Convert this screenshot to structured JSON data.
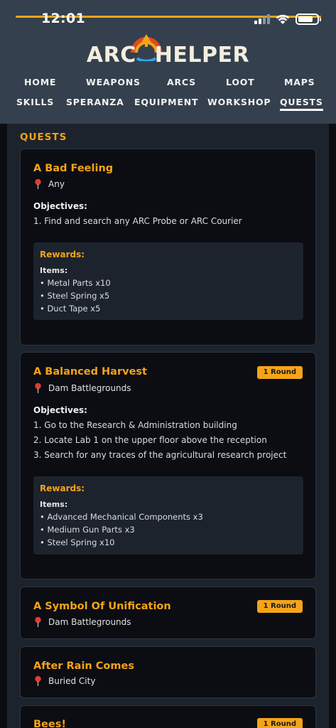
{
  "status": {
    "time": "12:01"
  },
  "logo": {
    "left": "ARC",
    "right": "HELPER"
  },
  "nav": {
    "row1": [
      "HOME",
      "WEAPONS",
      "ARCS",
      "LOOT",
      "MAPS"
    ],
    "row2": [
      "SKILLS",
      "SPERANZA",
      "EQUIPMENT",
      "WORKSHOP",
      "QUESTS"
    ],
    "active": "QUESTS"
  },
  "section_title": "QUESTS",
  "labels": {
    "objectives": "Objectives:",
    "rewards": "Rewards:",
    "items": "Items:",
    "bullet": "•"
  },
  "colors": {
    "accent": "#f5a418",
    "header_bg": "#34404d",
    "card_bg": "#0b0d12",
    "panel_bg": "#1c232d"
  },
  "quests": [
    {
      "title": "A Bad Feeling",
      "location": "Any",
      "badge": "",
      "objectives": [
        "1. Find and search any ARC Probe or ARC Courier"
      ],
      "rewards": [
        "Metal Parts x10",
        "Steel Spring x5",
        "Duct Tape x5"
      ]
    },
    {
      "title": "A Balanced Harvest",
      "location": "Dam Battlegrounds",
      "badge": "1 Round",
      "objectives": [
        "1. Go to the Research & Administration building",
        "2. Locate Lab 1 on the upper floor above the reception",
        "3. Search for any traces of the agricultural research project"
      ],
      "rewards": [
        "Advanced Mechanical Components x3",
        "Medium Gun Parts x3",
        "Steel Spring x10"
      ]
    },
    {
      "title": "A Symbol Of Unification",
      "location": "Dam Battlegrounds",
      "badge": "1 Round"
    },
    {
      "title": "After Rain Comes",
      "location": "Buried City",
      "badge": ""
    },
    {
      "title": "Bees!",
      "badge": "1 Round"
    }
  ]
}
